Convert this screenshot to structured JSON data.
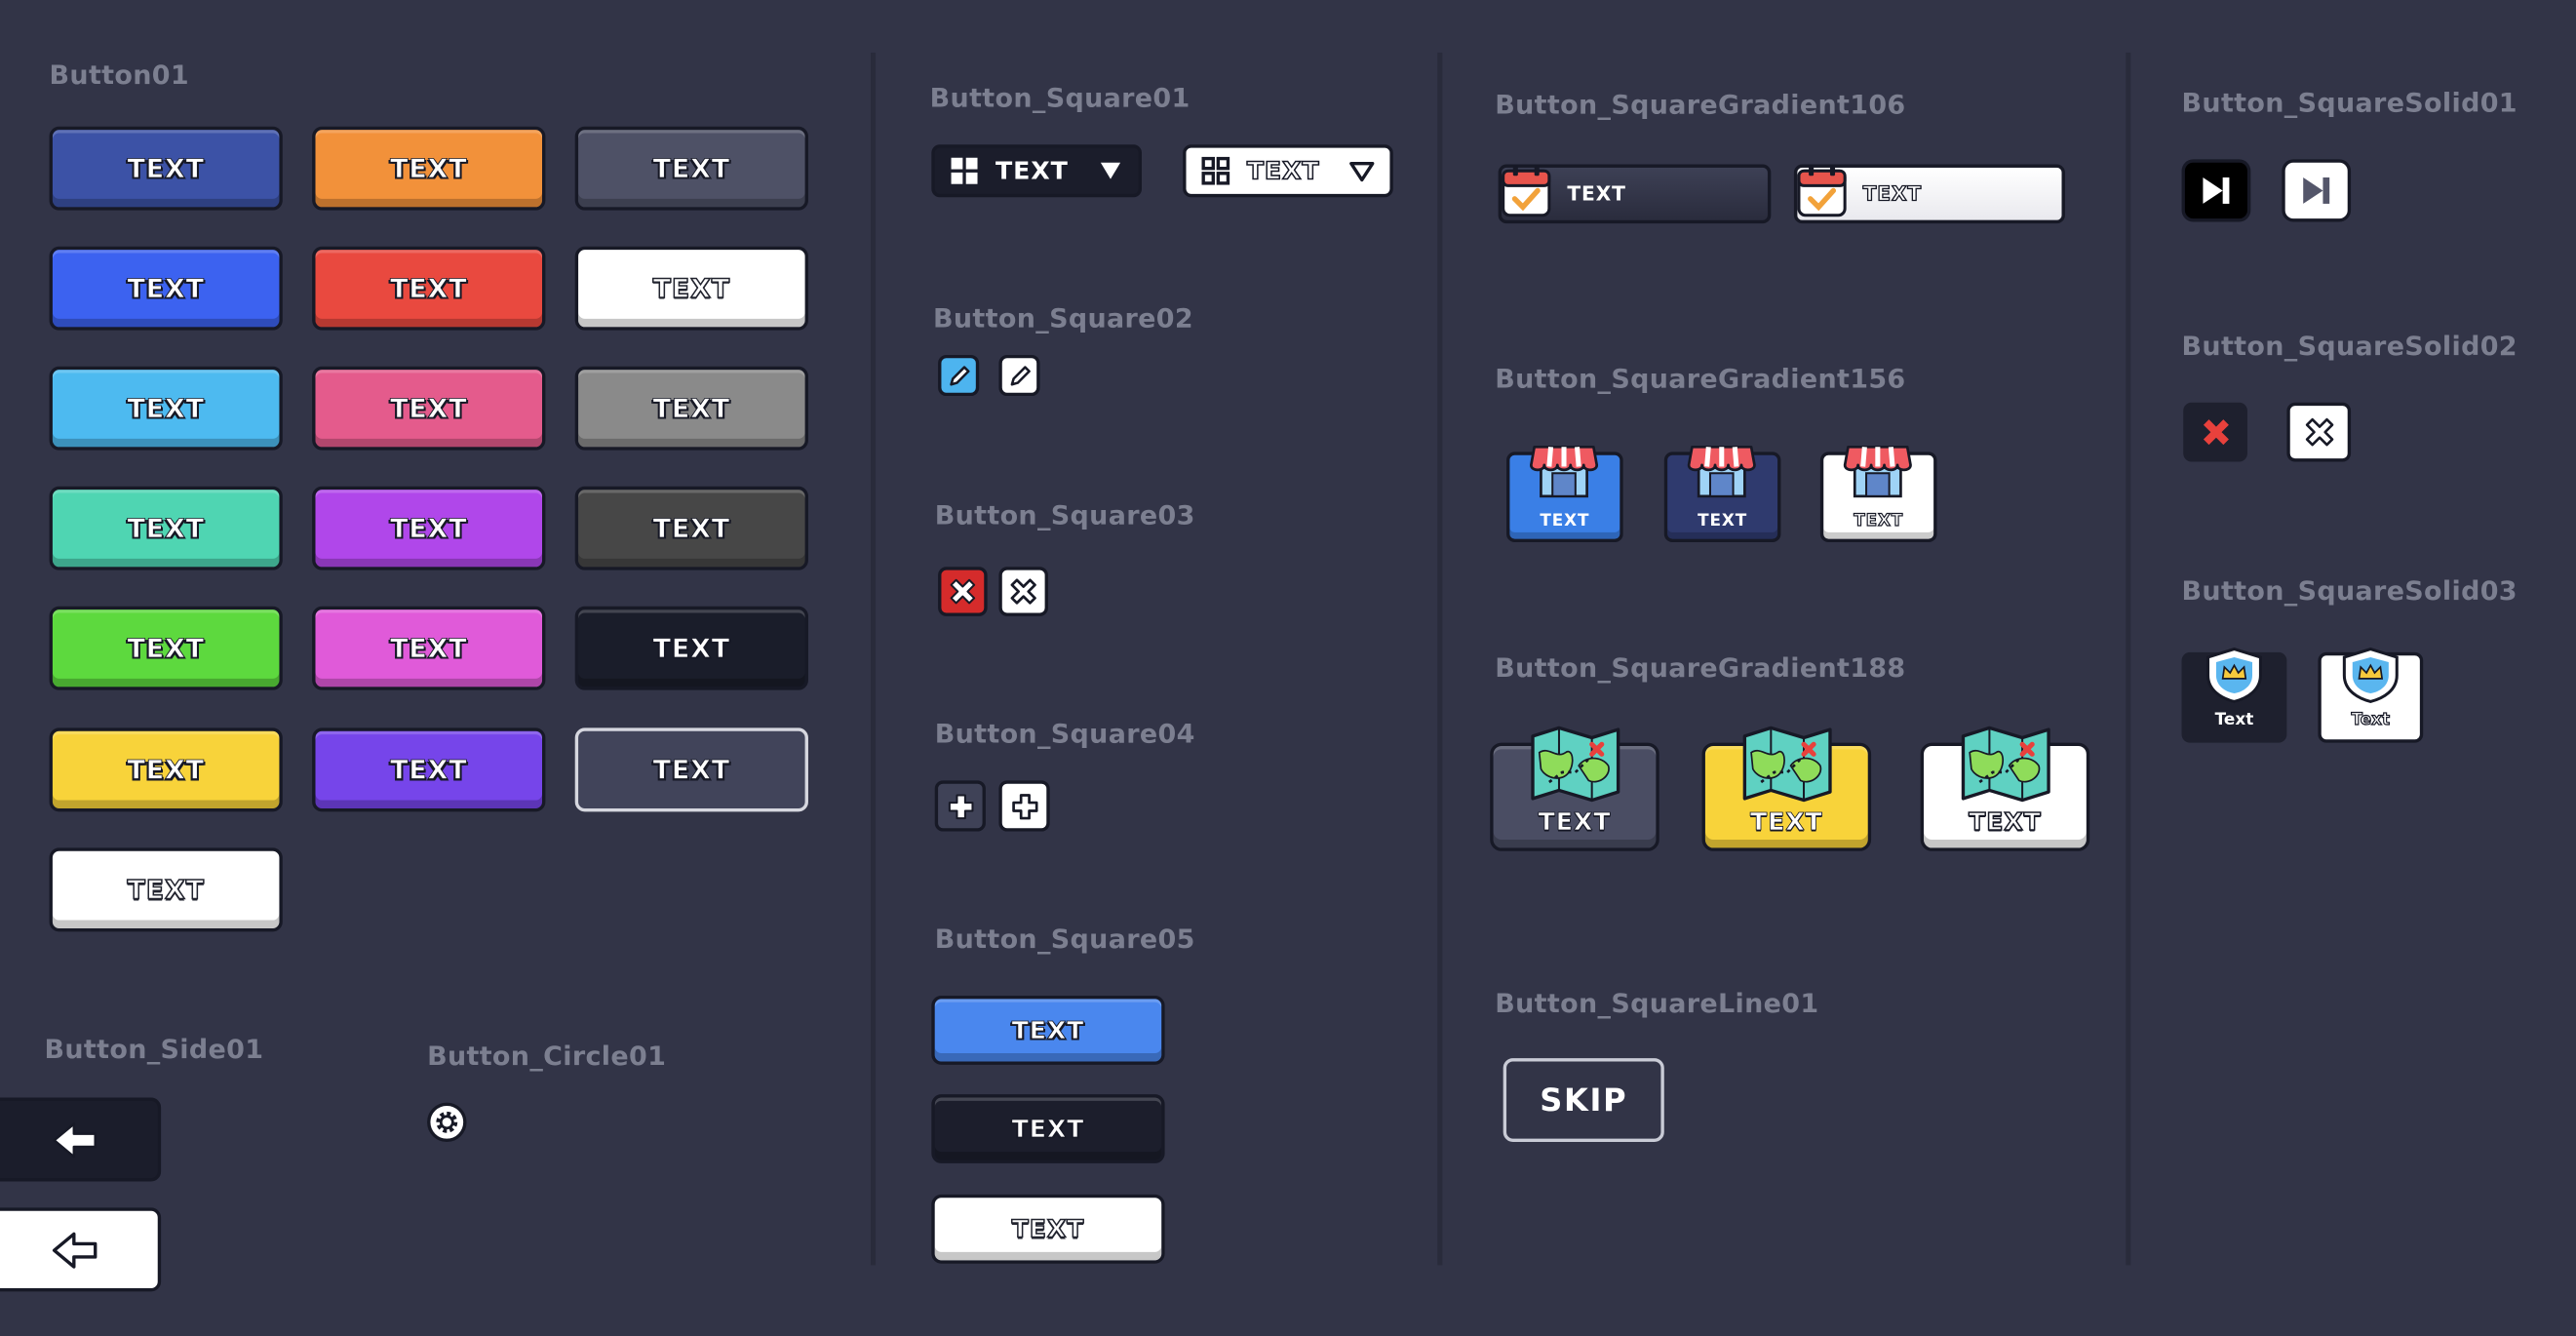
{
  "colors": {
    "background": "#323447",
    "section_title": "#7c7f90",
    "divider": "#292b3b",
    "btn_dark_navy": "#3c52a6",
    "btn_orange": "#f2913a",
    "btn_slate": "#4e5166",
    "btn_blue": "#3c62f0",
    "btn_red": "#e9493f",
    "btn_white": "#f0f0f0",
    "btn_sky": "#4dbaf0",
    "btn_pink": "#e45b8c",
    "btn_gray": "#8a8a8a",
    "btn_teal": "#4fd5b2",
    "btn_violet": "#b047ea",
    "btn_charcoal": "#474747",
    "btn_green": "#5dd93e",
    "btn_magenta": "#e05ad9",
    "btn_black": "#1a1d2a",
    "btn_yellow": "#f8d33a",
    "btn_purple": "#7645ea"
  },
  "icons": {
    "grid": "grid-icon",
    "dropdown": "triangle-down-icon",
    "pencil": "pencil-icon",
    "close": "close-x-icon",
    "plus": "plus-icon",
    "calendar": "calendar-check-icon",
    "shop": "shop-awning-icon",
    "map": "treasure-map-icon",
    "skip_forward": "skip-forward-icon",
    "shield_crown": "shield-crown-icon",
    "arrow_left": "arrow-left-icon",
    "gear": "gear-icon"
  },
  "sections": {
    "button01": "Button01",
    "side01": "Button_Side01",
    "circle01": "Button_Circle01",
    "square01": "Button_Square01",
    "square02": "Button_Square02",
    "square03": "Button_Square03",
    "square04": "Button_Square04",
    "square05": "Button_Square05",
    "gradient106": "Button_SquareGradient106",
    "gradient156": "Button_SquareGradient156",
    "gradient188": "Button_SquareGradient188",
    "line01": "Button_SquareLine01",
    "solid01": "Button_SquareSolid01",
    "solid02": "Button_SquareSolid02",
    "solid03": "Button_SquareSolid03"
  },
  "labels": {
    "text_upper": "TEXT",
    "text_title": "Text",
    "skip": "SKIP"
  }
}
